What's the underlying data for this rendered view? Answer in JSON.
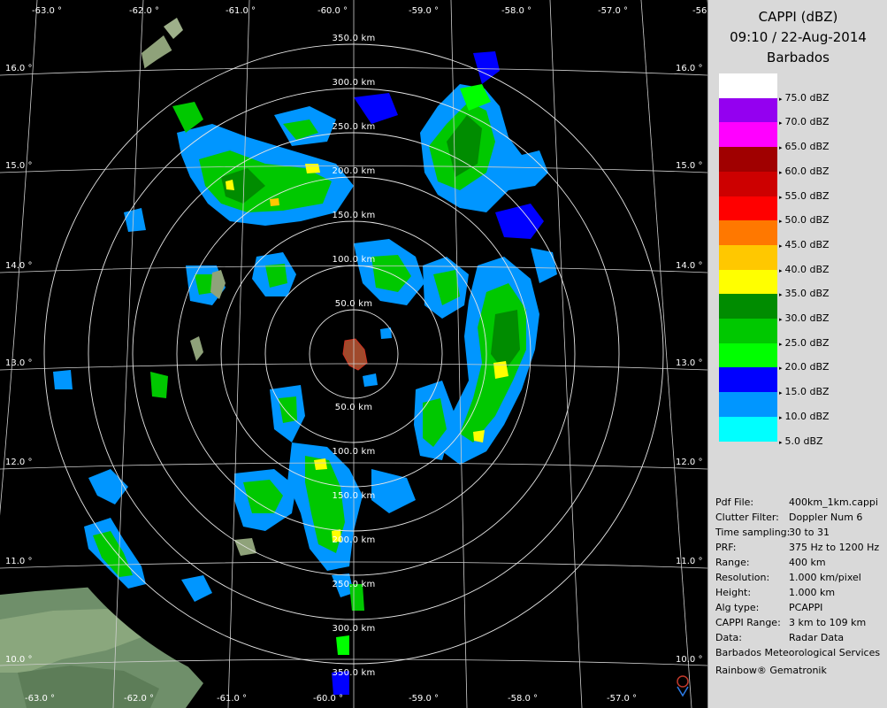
{
  "header": {
    "title": "CAPPI (dBZ)",
    "time": "09:10 / 22-Aug-2014",
    "station": "Barbados"
  },
  "legend": [
    {
      "color": "#ffffff",
      "label": "75.0 dBZ"
    },
    {
      "color": "#9400f0",
      "label": "70.0 dBZ"
    },
    {
      "color": "#ff00ff",
      "label": "65.0 dBZ"
    },
    {
      "color": "#a00000",
      "label": "60.0 dBZ"
    },
    {
      "color": "#cd0000",
      "label": "55.0 dBZ"
    },
    {
      "color": "#ff0000",
      "label": "50.0 dBZ"
    },
    {
      "color": "#ff7800",
      "label": "45.0 dBZ"
    },
    {
      "color": "#ffc800",
      "label": "40.0 dBZ"
    },
    {
      "color": "#ffff00",
      "label": "35.0 dBZ"
    },
    {
      "color": "#008c00",
      "label": "30.0 dBZ"
    },
    {
      "color": "#00c800",
      "label": "25.0 dBZ"
    },
    {
      "color": "#00ff00",
      "label": "20.0 dBZ"
    },
    {
      "color": "#0000ff",
      "label": "15.0 dBZ"
    },
    {
      "color": "#0096ff",
      "label": "10.0 dBZ"
    },
    {
      "color": "#00ffff",
      "label": "5.0 dBZ"
    }
  ],
  "info": [
    {
      "key": "Pdf File:",
      "value": "400km_1km.cappi"
    },
    {
      "key": "Clutter Filter:",
      "value": "Doppler Num 6"
    },
    {
      "key": "Time sampling:",
      "value": "30 to 31"
    },
    {
      "key": "PRF:",
      "value": "375 Hz to 1200 Hz"
    },
    {
      "key": "Range:",
      "value": "400 km"
    },
    {
      "key": "Resolution:",
      "value": "1.000 km/pixel"
    },
    {
      "key": "Height:",
      "value": "1.000 km"
    },
    {
      "key": "Alg type:",
      "value": "PCAPPI"
    },
    {
      "key": "CAPPI Range:",
      "value": "3 km to 109 km"
    },
    {
      "key": "Data:",
      "value": "Radar Data"
    }
  ],
  "footer": {
    "org": "Barbados Meteorological Services",
    "software": "Rainbow® Gematronik"
  },
  "map": {
    "range_labels_north": [
      "350.0 km",
      "300.0 km",
      "250.0 km",
      "200.0 km",
      "150.0 km",
      "100.0 km",
      "50.0 km"
    ],
    "range_labels_south": [
      "50.0 km",
      "100.0 km",
      "150.0 km",
      "200.0 km",
      "250.0 km",
      "300.0 km",
      "350.0 km"
    ],
    "lon_labels_top": [
      "-63.0 °",
      "-62.0 °",
      "-61.0 °",
      "-60.0 °",
      "-59.0 °",
      "-58.0 °",
      "-57.0 °",
      "-56"
    ],
    "lon_labels_bottom": [
      "-63.0 °",
      "-62.0 °",
      "-61.0 °",
      "-60.0 °",
      "-59.0 °",
      "-58.0 °",
      "-57.0 °"
    ],
    "lat_labels_left": [
      "16.0 °",
      "15.0 °",
      "14.0 °",
      "13.0 °",
      "12.0 °",
      "11.0 °",
      "10.0 °"
    ],
    "lat_labels_right": [
      "16.0 °",
      "15.0 °",
      "14.0 °",
      "13.0 °",
      "12.0 °",
      "11.0 °",
      "10.0 °"
    ]
  }
}
